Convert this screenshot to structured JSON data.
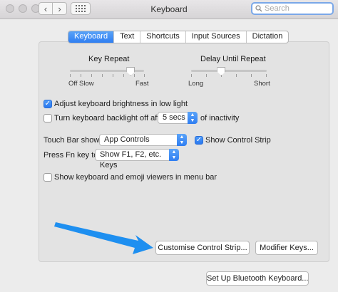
{
  "window": {
    "title": "Keyboard"
  },
  "search": {
    "placeholder": "Search"
  },
  "tabs": [
    {
      "label": "Keyboard",
      "active": true
    },
    {
      "label": "Text",
      "active": false
    },
    {
      "label": "Shortcuts",
      "active": false
    },
    {
      "label": "Input Sources",
      "active": false
    },
    {
      "label": "Dictation",
      "active": false
    }
  ],
  "key_repeat": {
    "title": "Key Repeat",
    "min_label": "Off",
    "mid_label": "Slow",
    "max_label": "Fast",
    "level": 0.82
  },
  "delay_until_repeat": {
    "title": "Delay Until Repeat",
    "min_label": "Long",
    "max_label": "Short",
    "level": 0.4
  },
  "options": {
    "adjust_brightness": {
      "label": "Adjust keyboard brightness in low light",
      "checked": true
    },
    "backlight_off": {
      "label_before": "Turn keyboard backlight off after",
      "value": "5 secs",
      "label_after": "of inactivity",
      "checked": false
    },
    "touch_bar": {
      "label": "Touch Bar shows",
      "value": "App Controls"
    },
    "show_control_strip": {
      "label": "Show Control Strip",
      "checked": true
    },
    "fn_key": {
      "label": "Press Fn key to",
      "value": "Show F1, F2, etc. Keys"
    },
    "emoji_viewers": {
      "label": "Show keyboard and emoji viewers in menu bar",
      "checked": false
    }
  },
  "buttons": {
    "customise": "Customise Control Strip...",
    "modifier": "Modifier Keys...",
    "bluetooth": "Set Up Bluetooth Keyboard..."
  },
  "colors": {
    "accent": "#2f7ef2",
    "annotation_arrow": "#1e8ff0"
  }
}
